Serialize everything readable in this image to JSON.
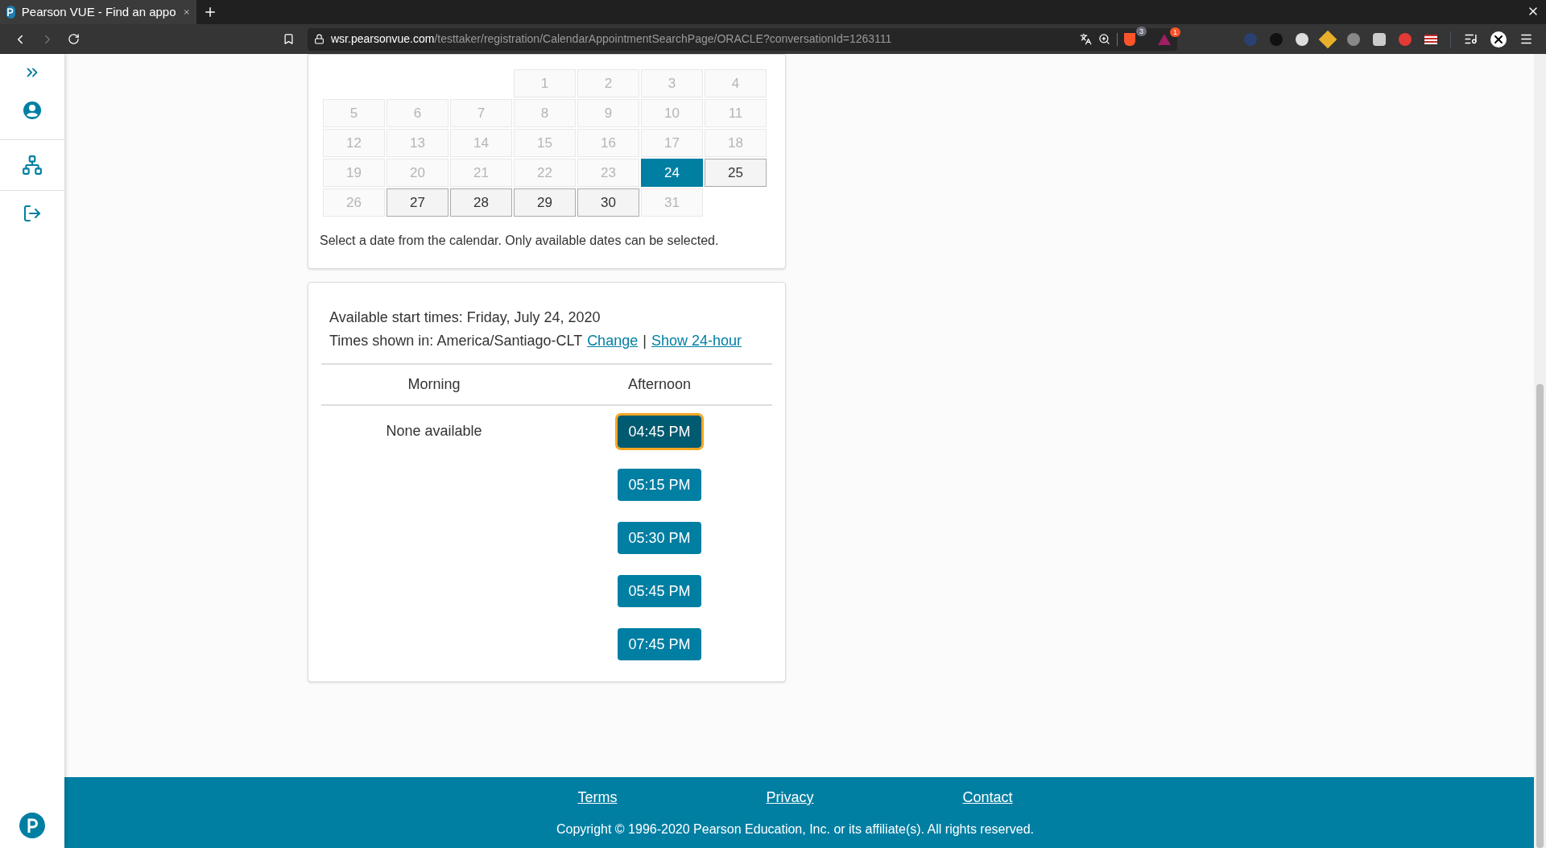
{
  "browser": {
    "tab_title": "Pearson VUE - Find an appo",
    "url_domain": "wsr.pearsonvue.com",
    "url_path": "/testtaker/registration/CalendarAppointmentSearchPage/ORACLE?conversationId=1263111",
    "shields_count": "3",
    "rewards_count": "1"
  },
  "calendar": {
    "weeks": [
      [
        {
          "kind": "blank"
        },
        {
          "kind": "blank"
        },
        {
          "kind": "blank"
        },
        {
          "day": "1",
          "available": false,
          "selected": false
        },
        {
          "day": "2",
          "available": false,
          "selected": false
        },
        {
          "day": "3",
          "available": false,
          "selected": false
        },
        {
          "day": "4",
          "available": false,
          "selected": false
        }
      ],
      [
        {
          "day": "5",
          "available": false,
          "selected": false
        },
        {
          "day": "6",
          "available": false,
          "selected": false
        },
        {
          "day": "7",
          "available": false,
          "selected": false
        },
        {
          "day": "8",
          "available": false,
          "selected": false
        },
        {
          "day": "9",
          "available": false,
          "selected": false
        },
        {
          "day": "10",
          "available": false,
          "selected": false
        },
        {
          "day": "11",
          "available": false,
          "selected": false
        }
      ],
      [
        {
          "day": "12",
          "available": false,
          "selected": false
        },
        {
          "day": "13",
          "available": false,
          "selected": false
        },
        {
          "day": "14",
          "available": false,
          "selected": false
        },
        {
          "day": "15",
          "available": false,
          "selected": false
        },
        {
          "day": "16",
          "available": false,
          "selected": false
        },
        {
          "day": "17",
          "available": false,
          "selected": false
        },
        {
          "day": "18",
          "available": false,
          "selected": false
        }
      ],
      [
        {
          "day": "19",
          "available": false,
          "selected": false
        },
        {
          "day": "20",
          "available": false,
          "selected": false
        },
        {
          "day": "21",
          "available": false,
          "selected": false
        },
        {
          "day": "22",
          "available": false,
          "selected": false
        },
        {
          "day": "23",
          "available": false,
          "selected": false
        },
        {
          "day": "24",
          "available": true,
          "selected": true
        },
        {
          "day": "25",
          "available": true,
          "selected": false
        }
      ],
      [
        {
          "day": "26",
          "available": false,
          "selected": false
        },
        {
          "day": "27",
          "available": true,
          "selected": false
        },
        {
          "day": "28",
          "available": true,
          "selected": false
        },
        {
          "day": "29",
          "available": true,
          "selected": false
        },
        {
          "day": "30",
          "available": true,
          "selected": false
        },
        {
          "day": "31",
          "available": false,
          "selected": false
        },
        {
          "kind": "blank"
        }
      ]
    ],
    "hint": "Select a date from the calendar. Only available dates can be selected."
  },
  "times": {
    "heading": "Available start times: Friday, July 24, 2020",
    "timezone_label": "Times shown in: America/Santiago-CLT",
    "links": [
      "Change",
      "Show 24-hour"
    ],
    "separator": "|",
    "columns": [
      {
        "heading": "Morning",
        "message": "None available"
      },
      {
        "heading": "Afternoon",
        "slots": [
          {
            "label": "04:45 PM",
            "selected": true
          },
          {
            "label": "05:15 PM",
            "selected": false
          },
          {
            "label": "05:30 PM",
            "selected": false
          },
          {
            "label": "05:45 PM",
            "selected": false
          },
          {
            "label": "07:45 PM",
            "selected": false
          }
        ]
      }
    ]
  },
  "footer": {
    "links": [
      "Terms",
      "Privacy",
      "Contact"
    ],
    "copyright": "Copyright © 1996-2020 Pearson Education, Inc. or its affiliate(s). All rights reserved."
  }
}
